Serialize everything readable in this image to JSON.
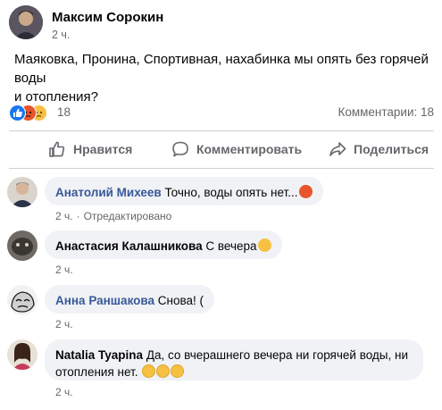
{
  "post": {
    "author": "Максим Сорокин",
    "time": "2 ч.",
    "text_line1": "Маяковка, Пронина, Спортивная, нахабинка мы опять без горячей воды",
    "text_line2": "и отопления?"
  },
  "reactions": {
    "count": "18",
    "comments_label": "Комментарии: 18",
    "icons": [
      "like-icon",
      "angry-icon",
      "sad-icon"
    ]
  },
  "actions": {
    "like": "Нравится",
    "comment": "Комментировать",
    "share": "Поделиться"
  },
  "comments": [
    {
      "author": "Анатолий Михеев",
      "text": "Точно, воды опять нет...",
      "time": "2 ч.",
      "edited": "Отредактировано"
    },
    {
      "author": "Анастасия Калашникова",
      "text": "С вечера",
      "time": "2 ч."
    },
    {
      "author": "Анна Раншакова",
      "text": "Снова! (",
      "time": "2 ч."
    },
    {
      "author": "Natalia Tyapina",
      "text_line1": "Да, со вчерашнего вечера ни горячей воды, ни",
      "text_line2": "отопления нет.",
      "time": "2 ч."
    }
  ],
  "colors": {
    "link_blue": "#385898",
    "meta_gray": "#65676b",
    "bubble_bg": "#f0f2f5"
  }
}
